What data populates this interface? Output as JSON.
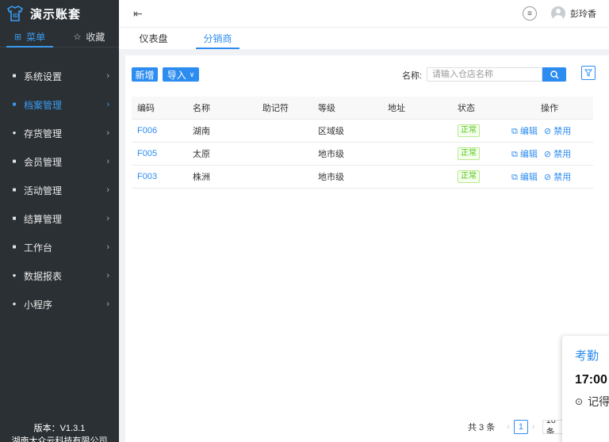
{
  "app": {
    "title": "演示账套"
  },
  "sidebar": {
    "tabs": [
      {
        "label": "菜单",
        "icon": "grid-icon"
      },
      {
        "label": "收藏",
        "icon": "star-icon"
      }
    ],
    "items": [
      {
        "label": "系统设置",
        "icon": "settings-icon"
      },
      {
        "label": "档案管理",
        "icon": "archive-icon"
      },
      {
        "label": "存货管理",
        "icon": "inventory-icon"
      },
      {
        "label": "会员管理",
        "icon": "member-icon"
      },
      {
        "label": "活动管理",
        "icon": "gift-icon"
      },
      {
        "label": "结算管理",
        "icon": "settlement-icon"
      },
      {
        "label": "工作台",
        "icon": "workbench-icon"
      },
      {
        "label": "数据报表",
        "icon": "report-icon"
      },
      {
        "label": "小程序",
        "icon": "miniapp-icon"
      }
    ],
    "version": "版本：V1.3.1",
    "company": "湖南大众云科技有限公司"
  },
  "header": {
    "username": "彭玲香"
  },
  "page_tabs": [
    "仪表盘",
    "分销商"
  ],
  "toolbar": {
    "add_label": "新增",
    "import_label": "导入",
    "filter_label": "名称:",
    "search_placeholder": "请输入仓店名称"
  },
  "table": {
    "columns": [
      "编码",
      "名称",
      "助记符",
      "等级",
      "地址",
      "状态",
      "操作"
    ],
    "rows": [
      {
        "code": "F006",
        "name": "湖南",
        "mnemonic": "",
        "level": "区域级",
        "address": "",
        "status": "正常"
      },
      {
        "code": "F005",
        "name": "太原",
        "mnemonic": "",
        "level": "地市级",
        "address": "",
        "status": "正常"
      },
      {
        "code": "F003",
        "name": "株洲",
        "mnemonic": "",
        "level": "地市级",
        "address": "",
        "status": "正常"
      }
    ],
    "edit_label": "编辑",
    "disable_label": "禁用"
  },
  "pagination": {
    "total": "共 3 条",
    "current": "1",
    "page_size": "10 条"
  },
  "popup": {
    "title": "考勤",
    "time": "17:00",
    "location": "记得"
  }
}
